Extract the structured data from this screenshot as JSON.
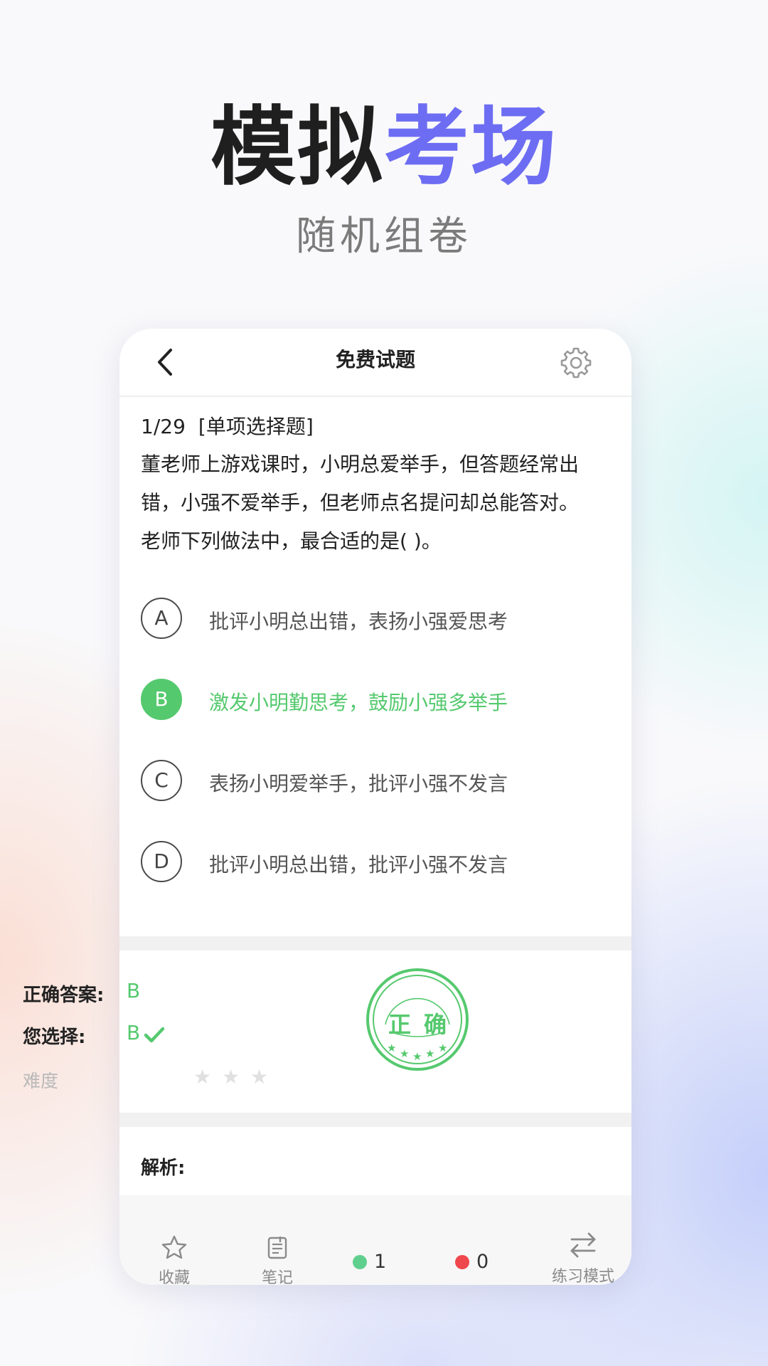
{
  "hero": {
    "title_dark": "模拟",
    "title_accent": "考场",
    "subtitle": "随机组卷",
    "accent_color": "#6d6df3"
  },
  "nav": {
    "title": "免费试题",
    "back_icon": "chevron-left-icon",
    "settings_icon": "gear-icon"
  },
  "question": {
    "index": "1/29",
    "type": "[单项选择题]",
    "lines": [
      "董老师上游戏课时，小明总爱举手，但答题经常出",
      "错，小强不爱举手，但老师点名提问却总能答对。",
      "老师下列做法中，最合适的是( )。"
    ]
  },
  "options": [
    {
      "letter": "A",
      "text": "批评小明总出错，表扬小强爱思考",
      "selected": false
    },
    {
      "letter": "B",
      "text": "激发小明勤思考，鼓励小强多举手",
      "selected": true
    },
    {
      "letter": "C",
      "text": "表扬小明爱举手，批评小强不发言",
      "selected": false
    },
    {
      "letter": "D",
      "text": "批评小明总出错，批评小强不发言",
      "selected": false
    }
  ],
  "answer": {
    "correct_label": "正确答案:",
    "correct_value": "B",
    "chosen_label": "您选择:",
    "chosen_value": "B",
    "difficulty_label": "难度",
    "difficulty_stars": 0,
    "difficulty_max": 3,
    "stamp_text": "正确",
    "correct_color": "#55c96e"
  },
  "analysis": {
    "label": "解析:"
  },
  "bottom_bar": {
    "favorite_label": "收藏",
    "notes_label": "笔记",
    "correct_count": "1",
    "wrong_count": "0",
    "mode_label": "练习模式",
    "correct_dot_color": "#5fcf8e",
    "wrong_dot_color": "#f0474c"
  }
}
